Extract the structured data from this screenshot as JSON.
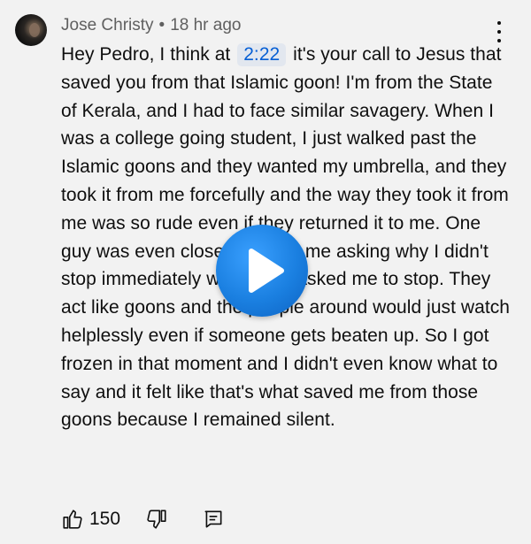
{
  "comment": {
    "author": "Jose Christy",
    "separator": "•",
    "time": "18 hr ago",
    "text_before_timestamp": "Hey Pedro, I think at ",
    "timestamp": "2:22",
    "text_after_timestamp": " it's your call to Jesus that saved you from that Islamic goon! I'm from the State of Kerala, and I had to face similar savagery. When I was a college going student, I just walked past the Islamic goons and they wanted my umbrella, and they took it from me forcefully and the way they took it from me was so rude even if they returned it to me. One guy was even close to hitting me asking why I didn't stop immediately when they asked me to stop. They act like goons and the people around would just watch helplessly even if someone gets beaten up. So I got frozen in that moment and I didn't even know what to say and it felt like that's what saved me from those goons because I remained silent.",
    "like_count": "150"
  },
  "icons": {
    "more": "more-vertical-icon",
    "like": "thumbs-up-icon",
    "dislike": "thumbs-down-icon",
    "reply": "reply-comment-icon",
    "play": "play-icon"
  },
  "colors": {
    "background": "#f2f2f2",
    "timestamp_link": "#065fd4",
    "play_button": "#1a7fe0"
  }
}
